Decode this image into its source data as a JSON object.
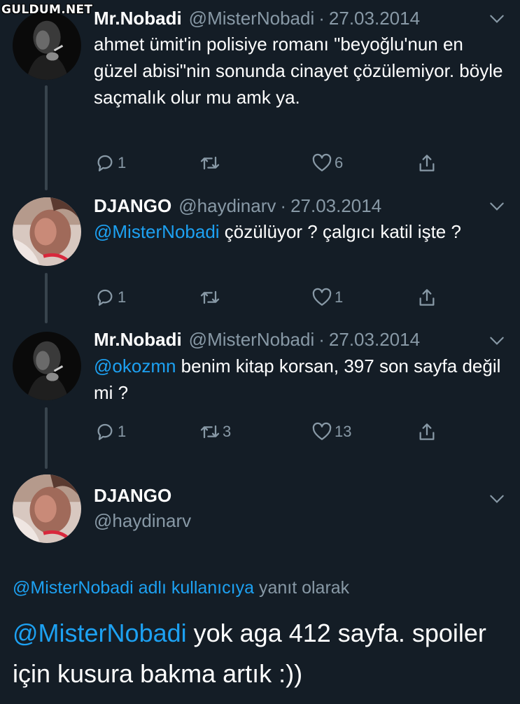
{
  "watermark": "GULDUM.NET",
  "colors": {
    "background": "#141d26",
    "link": "#1da1f2",
    "secondary_text": "#8899a6",
    "thread_line": "#38444d"
  },
  "tweets": [
    {
      "name": "Mr.Nobadi",
      "handle": "@MisterNobadi",
      "separator": "·",
      "date": "27.03.2014",
      "mention": "",
      "text": "ahmet ümit'in polisiye romanı \"beyoğlu'nun en güzel abisi\"nin sonunda cinayet çözülemiyor. böyle saçmalık olur mu amk ya.",
      "replies": "1",
      "retweets": "",
      "likes": "6"
    },
    {
      "name": "DJANGO",
      "handle": "@haydinarv",
      "separator": "·",
      "date": "27.03.2014",
      "mention": "@MisterNobadi",
      "text": "çözülüyor ? çalgıcı katil işte ?",
      "replies": "1",
      "retweets": "",
      "likes": "1"
    },
    {
      "name": "Mr.Nobadi",
      "handle": "@MisterNobadi",
      "separator": "·",
      "date": "27.03.2014",
      "mention": "@okozmn",
      "text": "benim kitap korsan, 397 son sayfa değil mi ?",
      "replies": "1",
      "retweets": "3",
      "likes": "13"
    }
  ],
  "focused_tweet": {
    "name": "DJANGO",
    "handle": "@haydinarv",
    "reply_context_mention": "@MisterNobadi adlı kullanıcıya",
    "reply_context_suffix": "yanıt olarak",
    "mention": "@MisterNobadi",
    "text": "yok aga 412 sayfa. spoiler için kusura bakma artık :))"
  },
  "icons": {
    "reply": "reply-icon",
    "retweet": "retweet-icon",
    "like": "heart-icon",
    "share": "share-icon",
    "more": "chevron-down-icon"
  }
}
